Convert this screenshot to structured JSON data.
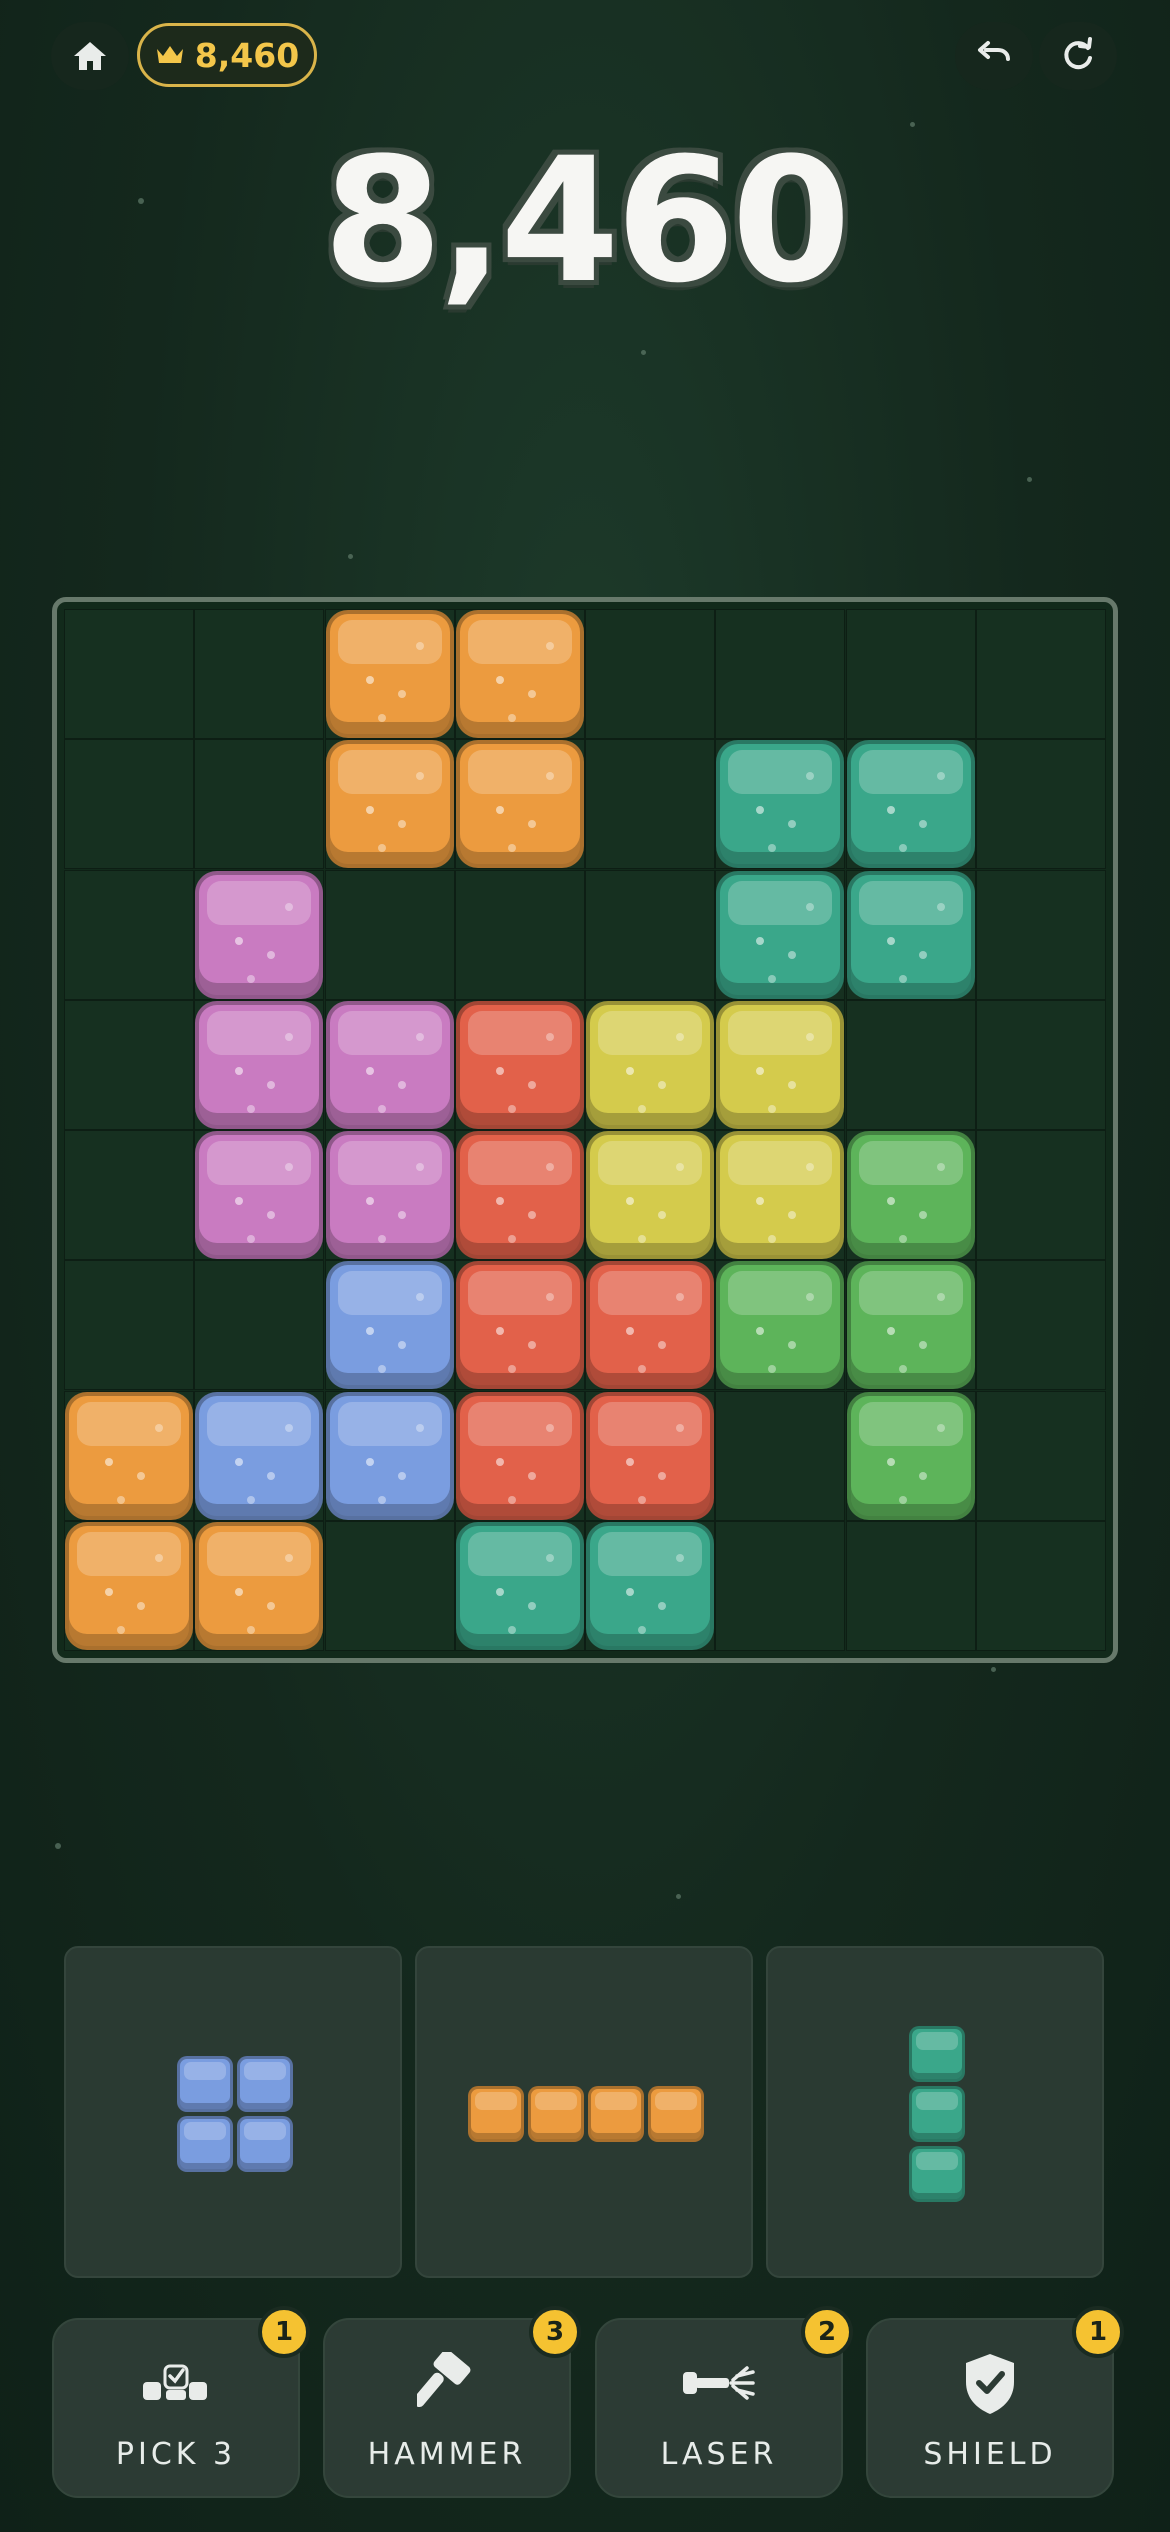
{
  "header": {
    "best_score": "8,460",
    "home_icon": "home-icon",
    "crown_icon": "crown-icon",
    "undo_icon": "undo-icon",
    "restart_icon": "restart-icon"
  },
  "score": "8,460",
  "colors": {
    "orange": "#ec9b3f",
    "teal": "#3aa78a",
    "purple": "#c97bc1",
    "red": "#e2614a",
    "yellow": "#d4cb4c",
    "green": "#5db45a",
    "blue": "#7a9de0"
  },
  "board": {
    "size": 8,
    "cells": [
      {
        "row": 0,
        "col": 2,
        "color": "orange"
      },
      {
        "row": 0,
        "col": 3,
        "color": "orange"
      },
      {
        "row": 1,
        "col": 2,
        "color": "orange"
      },
      {
        "row": 1,
        "col": 3,
        "color": "orange"
      },
      {
        "row": 1,
        "col": 5,
        "color": "teal"
      },
      {
        "row": 1,
        "col": 6,
        "color": "teal"
      },
      {
        "row": 2,
        "col": 1,
        "color": "purple"
      },
      {
        "row": 2,
        "col": 5,
        "color": "teal"
      },
      {
        "row": 2,
        "col": 6,
        "color": "teal"
      },
      {
        "row": 3,
        "col": 1,
        "color": "purple"
      },
      {
        "row": 3,
        "col": 2,
        "color": "purple"
      },
      {
        "row": 3,
        "col": 3,
        "color": "red"
      },
      {
        "row": 3,
        "col": 4,
        "color": "yellow"
      },
      {
        "row": 3,
        "col": 5,
        "color": "yellow"
      },
      {
        "row": 4,
        "col": 1,
        "color": "purple"
      },
      {
        "row": 4,
        "col": 2,
        "color": "purple"
      },
      {
        "row": 4,
        "col": 3,
        "color": "red"
      },
      {
        "row": 4,
        "col": 4,
        "color": "yellow"
      },
      {
        "row": 4,
        "col": 5,
        "color": "yellow"
      },
      {
        "row": 4,
        "col": 6,
        "color": "green"
      },
      {
        "row": 5,
        "col": 2,
        "color": "blue"
      },
      {
        "row": 5,
        "col": 3,
        "color": "red"
      },
      {
        "row": 5,
        "col": 4,
        "color": "red"
      },
      {
        "row": 5,
        "col": 5,
        "color": "green"
      },
      {
        "row": 5,
        "col": 6,
        "color": "green"
      },
      {
        "row": 6,
        "col": 0,
        "color": "orange"
      },
      {
        "row": 6,
        "col": 1,
        "color": "blue"
      },
      {
        "row": 6,
        "col": 2,
        "color": "blue"
      },
      {
        "row": 6,
        "col": 3,
        "color": "red"
      },
      {
        "row": 6,
        "col": 4,
        "color": "red"
      },
      {
        "row": 6,
        "col": 6,
        "color": "green"
      },
      {
        "row": 7,
        "col": 0,
        "color": "orange"
      },
      {
        "row": 7,
        "col": 1,
        "color": "orange"
      },
      {
        "row": 7,
        "col": 3,
        "color": "teal"
      },
      {
        "row": 7,
        "col": 4,
        "color": "teal"
      }
    ]
  },
  "pieces": [
    {
      "color": "blue",
      "cells": [
        [
          0,
          0
        ],
        [
          0,
          1
        ],
        [
          1,
          0
        ],
        [
          1,
          1
        ]
      ]
    },
    {
      "color": "orange",
      "cells": [
        [
          0,
          0
        ],
        [
          0,
          1
        ],
        [
          0,
          2
        ],
        [
          0,
          3
        ]
      ]
    },
    {
      "color": "teal",
      "cells": [
        [
          0,
          0
        ],
        [
          1,
          0
        ],
        [
          2,
          0
        ]
      ]
    }
  ],
  "powerups": [
    {
      "label": "PICK 3",
      "count": "1",
      "icon": "pick-three-icon"
    },
    {
      "label": "HAMMER",
      "count": "3",
      "icon": "hammer-icon"
    },
    {
      "label": "LASER",
      "count": "2",
      "icon": "laser-icon"
    },
    {
      "label": "SHIELD",
      "count": "1",
      "icon": "shield-icon"
    }
  ]
}
